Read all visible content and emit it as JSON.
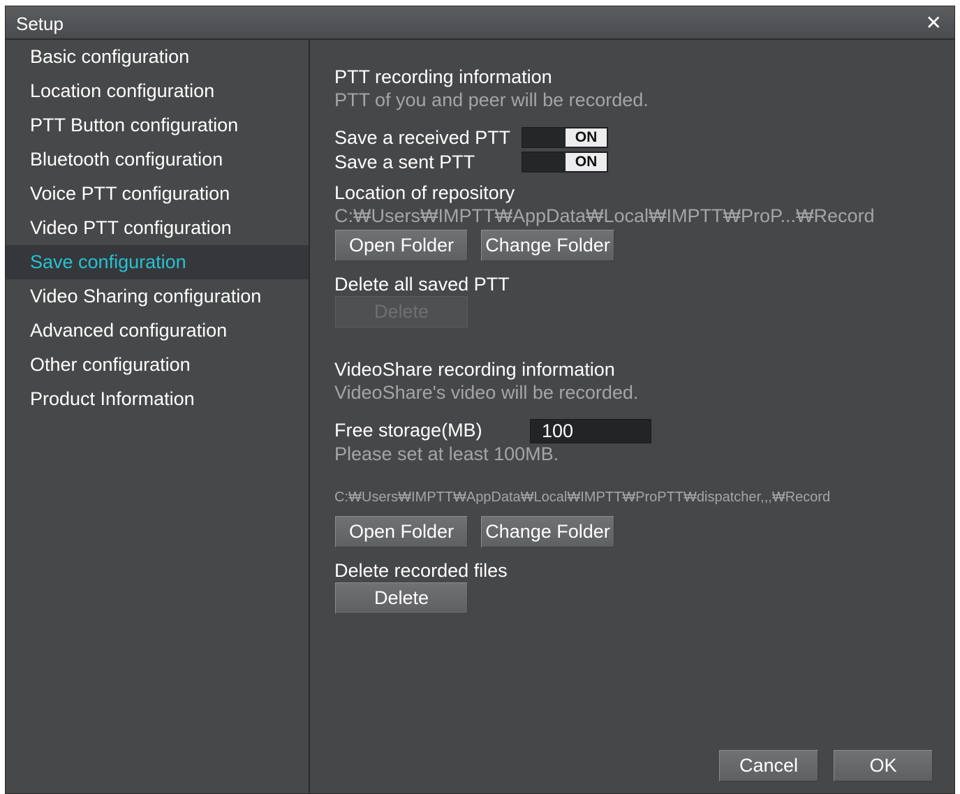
{
  "window": {
    "title": "Setup",
    "close_symbol": "✕"
  },
  "sidebar": {
    "items": [
      {
        "label": "Basic configuration"
      },
      {
        "label": "Location configuration"
      },
      {
        "label": "PTT Button configuration"
      },
      {
        "label": "Bluetooth configuration"
      },
      {
        "label": "Voice PTT configuration"
      },
      {
        "label": "Video PTT configuration"
      },
      {
        "label": "Save configuration",
        "active": true
      },
      {
        "label": "Video Sharing configuration"
      },
      {
        "label": "Advanced configuration"
      },
      {
        "label": "Other configuration"
      },
      {
        "label": "Product Information"
      }
    ]
  },
  "ptt": {
    "heading": "PTT recording information",
    "description": "PTT of you and peer will be recorded.",
    "save_received_label": "Save a received PTT",
    "save_received_state": "ON",
    "save_sent_label": "Save a sent PTT",
    "save_sent_state": "ON",
    "repository_label": "Location of repository",
    "repository_path": "C:₩Users₩IMPTT₩AppData₩Local₩IMPTT₩ProP...₩Record",
    "open_folder": "Open Folder",
    "change_folder": "Change Folder",
    "delete_all_label": "Delete all saved PTT",
    "delete_button": "Delete"
  },
  "videoshare": {
    "heading": "VideoShare recording information",
    "description": "VideoShare's video will be recorded.",
    "free_storage_label": "Free storage(MB)",
    "free_storage_value": "100",
    "free_storage_hint": "Please set at least 100MB.",
    "path": "C:₩Users₩IMPTT₩AppData₩Local₩IMPTT₩ProPTT₩dispatcher,,,₩Record",
    "open_folder": "Open Folder",
    "change_folder": "Change Folder",
    "delete_recorded_label": "Delete recorded files",
    "delete_button": "Delete"
  },
  "footer": {
    "cancel": "Cancel",
    "ok": "OK"
  },
  "colors": {
    "accent": "#25c2d3",
    "background": "#464749",
    "titlebar": "#545558"
  }
}
